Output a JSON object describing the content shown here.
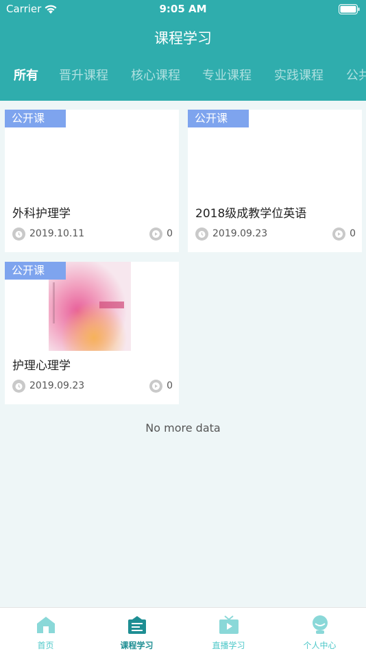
{
  "status_bar": {
    "carrier": "Carrier",
    "time": "9:05 AM"
  },
  "nav": {
    "title": "课程学习"
  },
  "tabs": [
    {
      "label": "所有",
      "active": true
    },
    {
      "label": "晋升课程",
      "active": false
    },
    {
      "label": "核心课程",
      "active": false
    },
    {
      "label": "专业课程",
      "active": false
    },
    {
      "label": "实践课程",
      "active": false
    },
    {
      "label": "公共",
      "active": false
    }
  ],
  "courses": [
    {
      "badge": "公开课",
      "title": "外科护理学",
      "date": "2019.10.11",
      "views": "0",
      "has_cover": false
    },
    {
      "badge": "公开课",
      "title": "2018级成教学位英语",
      "date": "2019.09.23",
      "views": "0",
      "has_cover": false
    },
    {
      "badge": "公开课",
      "title": "护理心理学",
      "date": "2019.09.23",
      "views": "0",
      "has_cover": true
    }
  ],
  "footer_note": "No more data",
  "tabbar": [
    {
      "label": "首页",
      "icon": "home-icon",
      "active": false
    },
    {
      "label": "课程学习",
      "icon": "course-icon",
      "active": true
    },
    {
      "label": "直播学习",
      "icon": "live-tv-icon",
      "active": false
    },
    {
      "label": "个人中心",
      "icon": "profile-icon",
      "active": false
    }
  ],
  "colors": {
    "header": "#2fadad",
    "badge": "#7ea4ee",
    "tab_accent": "#4fc8c9",
    "tab_active": "#1e8e93"
  }
}
